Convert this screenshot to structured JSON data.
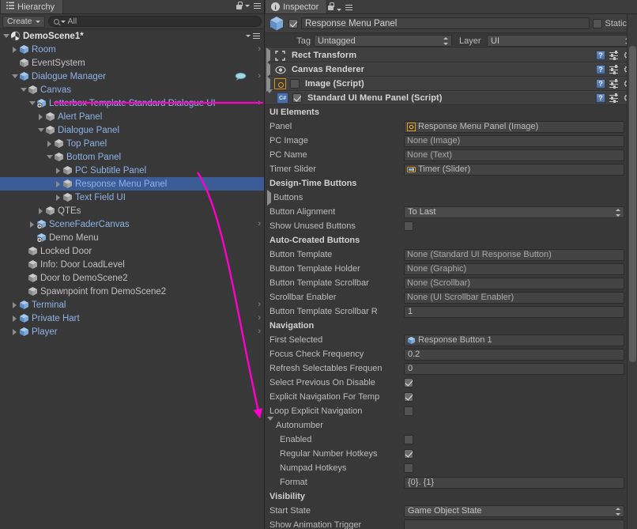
{
  "hierarchy": {
    "tab_label": "Hierarchy",
    "tab_icon": "hierarchy-icon",
    "lock_icon": "lock-icon",
    "menu_icon": "hamburger-menu-icon",
    "toolbar": {
      "create_label": "Create",
      "create_caret": "▾",
      "search_placeholder": "All",
      "search_value": "All",
      "search_icon": "search-icon"
    },
    "rows": [
      {
        "label": "DemoScene1*",
        "depth": 0,
        "tri": "open",
        "icon": "unity-scene-icon",
        "color": "white",
        "chev": false,
        "sel": false,
        "scene": true
      },
      {
        "label": "Room",
        "depth": 1,
        "tri": "closed",
        "icon": "prefab-cube-icon",
        "color": "blue",
        "chev": true,
        "sel": false
      },
      {
        "label": "EventSystem",
        "depth": 1,
        "tri": "none",
        "icon": "gameobject-cube-icon",
        "color": "grey",
        "chev": false,
        "sel": false
      },
      {
        "label": "Dialogue Manager",
        "depth": 1,
        "tri": "open",
        "icon": "prefab-cube-icon",
        "color": "blue",
        "chev": true,
        "sel": false,
        "extra": "dialogue-icon"
      },
      {
        "label": "Canvas",
        "depth": 2,
        "tri": "open",
        "icon": "gameobject-cube-icon",
        "color": "blue",
        "chev": false,
        "sel": false
      },
      {
        "label": "Letterbox Template Standard Dialogue UI",
        "depth": 3,
        "tri": "open",
        "icon": "prefab-variant-icon",
        "color": "blue",
        "chev": true,
        "sel": false
      },
      {
        "label": "Alert Panel",
        "depth": 4,
        "tri": "closed",
        "icon": "gameobject-cube-icon",
        "color": "blue",
        "chev": false,
        "sel": false
      },
      {
        "label": "Dialogue Panel",
        "depth": 4,
        "tri": "open",
        "icon": "gameobject-cube-icon",
        "color": "blue",
        "chev": false,
        "sel": false
      },
      {
        "label": "Top Panel",
        "depth": 5,
        "tri": "closed",
        "icon": "gameobject-cube-icon",
        "color": "blue",
        "chev": false,
        "sel": false
      },
      {
        "label": "Bottom Panel",
        "depth": 5,
        "tri": "open",
        "icon": "gameobject-cube-icon",
        "color": "blue",
        "chev": false,
        "sel": false
      },
      {
        "label": "PC Subtitle Panel",
        "depth": 6,
        "tri": "closed",
        "icon": "gameobject-cube-icon",
        "color": "blue",
        "chev": false,
        "sel": false
      },
      {
        "label": "Response Menu Panel",
        "depth": 6,
        "tri": "closed",
        "icon": "gameobject-cube-icon",
        "color": "blue",
        "chev": false,
        "sel": true
      },
      {
        "label": "Text Field UI",
        "depth": 6,
        "tri": "closed",
        "icon": "gameobject-cube-icon",
        "color": "blue",
        "chev": false,
        "sel": false
      },
      {
        "label": "QTEs",
        "depth": 4,
        "tri": "closed",
        "icon": "gameobject-cube-icon",
        "color": "grey",
        "chev": false,
        "sel": false
      },
      {
        "label": "SceneFaderCanvas",
        "depth": 3,
        "tri": "closed",
        "icon": "prefab-variant-icon",
        "color": "blue",
        "chev": true,
        "sel": false
      },
      {
        "label": "Demo Menu",
        "depth": 3,
        "tri": "none",
        "icon": "prefab-variant-icon",
        "color": "grey",
        "chev": false,
        "sel": false
      },
      {
        "label": "Locked Door",
        "depth": 2,
        "tri": "none",
        "icon": "gameobject-cube-icon",
        "color": "grey",
        "chev": false,
        "sel": false
      },
      {
        "label": "Info: Door LoadLevel",
        "depth": 2,
        "tri": "none",
        "icon": "gameobject-cube-icon",
        "color": "grey",
        "chev": false,
        "sel": false
      },
      {
        "label": "Door to DemoScene2",
        "depth": 2,
        "tri": "none",
        "icon": "gameobject-cube-icon",
        "color": "grey",
        "chev": false,
        "sel": false
      },
      {
        "label": "Spawnpoint from DemoScene2",
        "depth": 2,
        "tri": "none",
        "icon": "gameobject-cube-icon",
        "color": "grey",
        "chev": false,
        "sel": false
      },
      {
        "label": "Terminal",
        "depth": 1,
        "tri": "closed",
        "icon": "prefab-cube-icon",
        "color": "blue",
        "chev": true,
        "sel": false
      },
      {
        "label": "Private Hart",
        "depth": 1,
        "tri": "closed",
        "icon": "prefab-cube-icon",
        "color": "blue",
        "chev": true,
        "sel": false
      },
      {
        "label": "Player",
        "depth": 1,
        "tri": "closed",
        "icon": "prefab-cube-icon",
        "color": "blue",
        "chev": true,
        "sel": false
      }
    ]
  },
  "inspector": {
    "tab_label": "Inspector",
    "tab_icon": "info-icon",
    "lock_icon": "lock-icon",
    "menu_icon": "hamburger-menu-icon",
    "gameobject": {
      "icon": "gameobject-cube-icon",
      "enabled": true,
      "name": "Response Menu Panel",
      "static_label": "Static",
      "static_checked": false,
      "tag_label": "Tag",
      "tag_value": "Untagged",
      "layer_label": "Layer",
      "layer_value": "UI"
    },
    "components": [
      {
        "title": "Rect Transform",
        "icon": "rect-transform-icon",
        "expanded": false,
        "checkbox": "none"
      },
      {
        "title": "Canvas Renderer",
        "icon": "eye-icon",
        "expanded": false,
        "checkbox": "none"
      },
      {
        "title": "Image (Script)",
        "icon": "image-script-icon",
        "expanded": false,
        "checkbox": "off"
      },
      {
        "title": "Standard UI Menu Panel (Script)",
        "icon": "csharp-script-icon",
        "expanded": true,
        "checkbox": "on"
      }
    ],
    "component_row_icons": {
      "help": "help-icon",
      "preset": "preset-icon",
      "gear": "gear-icon"
    },
    "properties": [
      {
        "kind": "header",
        "label": "UI Elements"
      },
      {
        "kind": "object",
        "label": "Panel",
        "value": "Response Menu Panel (Image)",
        "filled": true,
        "badge": "image-badge-icon"
      },
      {
        "kind": "object",
        "label": "PC Image",
        "value": "None (Image)",
        "filled": false
      },
      {
        "kind": "object",
        "label": "PC Name",
        "value": "None (Text)",
        "filled": false
      },
      {
        "kind": "object",
        "label": "Timer Slider",
        "value": "Timer (Slider)",
        "filled": true,
        "badge": "slider-badge-icon"
      },
      {
        "kind": "header",
        "label": "Design-Time Buttons"
      },
      {
        "kind": "foldout",
        "label": "Buttons",
        "expanded": false
      },
      {
        "kind": "popup",
        "label": "Button Alignment",
        "value": "To Last"
      },
      {
        "kind": "toggle",
        "label": "Show Unused Buttons",
        "checked": false
      },
      {
        "kind": "header",
        "label": "Auto-Created Buttons"
      },
      {
        "kind": "object",
        "label": "Button Template",
        "value": "None (Standard UI Response Button)",
        "filled": false
      },
      {
        "kind": "object",
        "label": "Button Template Holder",
        "value": "None (Graphic)",
        "filled": false
      },
      {
        "kind": "object",
        "label": "Button Template Scrollbar",
        "value": "None (Scrollbar)",
        "filled": false
      },
      {
        "kind": "object",
        "label": "Scrollbar Enabler",
        "value": "None (UI Scrollbar Enabler)",
        "filled": false
      },
      {
        "kind": "number",
        "label": "Button Template Scrollbar R",
        "value": "1"
      },
      {
        "kind": "header",
        "label": "Navigation"
      },
      {
        "kind": "object",
        "label": "First Selected",
        "value": "Response Button 1",
        "filled": true,
        "badge": "prefab-cube-icon"
      },
      {
        "kind": "number",
        "label": "Focus Check Frequency",
        "value": "0.2"
      },
      {
        "kind": "number",
        "label": "Refresh Selectables Frequen",
        "value": "0"
      },
      {
        "kind": "toggle",
        "label": "Select Previous On Disable",
        "checked": true
      },
      {
        "kind": "toggle",
        "label": "Explicit Navigation For Temp",
        "checked": true
      },
      {
        "kind": "toggle",
        "label": "Loop Explicit Navigation",
        "checked": false
      },
      {
        "kind": "foldout",
        "label": "Autonumber",
        "expanded": true
      },
      {
        "kind": "toggle",
        "label": "Enabled",
        "checked": false,
        "indent": true
      },
      {
        "kind": "toggle",
        "label": "Regular Number Hotkeys",
        "checked": true,
        "indent": true
      },
      {
        "kind": "toggle",
        "label": "Numpad Hotkeys",
        "checked": false,
        "indent": true
      },
      {
        "kind": "text",
        "label": "Format",
        "value": "{0}. {1}",
        "indent": true
      },
      {
        "kind": "header",
        "label": "Visibility"
      },
      {
        "kind": "popup",
        "label": "Start State",
        "value": "Game Object State"
      },
      {
        "kind": "text",
        "label": "Show Animation Trigger",
        "value": ""
      }
    ],
    "scrollbar": {
      "name": "inspector-scrollbar"
    }
  },
  "annotation": {
    "color": "#ff00cc",
    "underline_target": "Letterbox Template Standard Dialogue UI",
    "arrow_from": "Response Menu Panel",
    "arrow_to": "Autonumber"
  }
}
